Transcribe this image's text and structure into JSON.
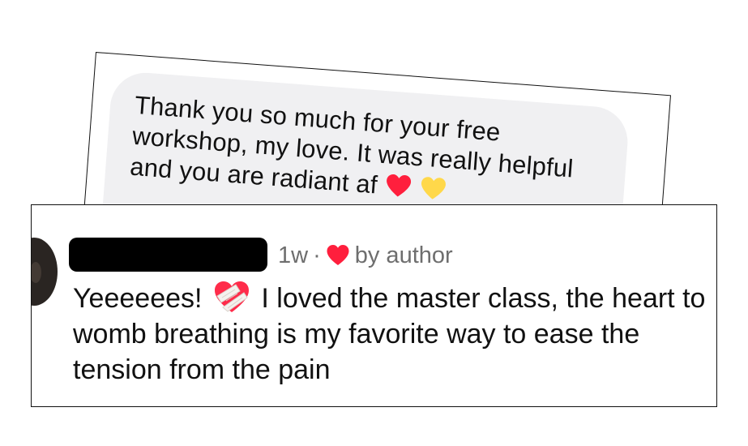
{
  "dm_message": {
    "text": "Thank you so much for your free workshop, my love. It was really helpful and you are radiant af"
  },
  "comment": {
    "time": "1w",
    "separator": "·",
    "liked_by": "by author",
    "text_before_emoji": "Yeeeeees!",
    "text_after_emoji": " I loved the master class, the heart to womb breathing is my favorite way to ease the tension from the pain",
    "emoji": "mending-heart-icon"
  },
  "colors": {
    "bubble_bg": "#f0f0f2",
    "meta_gray": "#6e6e6e",
    "heart_red": "#ff1f3d",
    "redaction": "#000000"
  }
}
